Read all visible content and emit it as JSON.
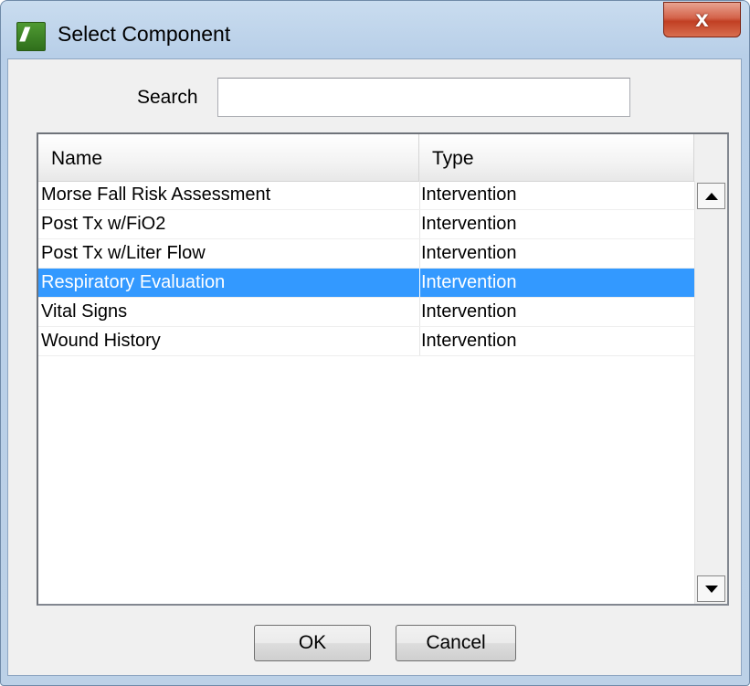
{
  "window": {
    "title": "Select Component",
    "icon": "app-logo-icon",
    "icon_glyph": "///",
    "close_glyph": "x"
  },
  "search": {
    "label": "Search",
    "value": "",
    "placeholder": ""
  },
  "table": {
    "columns": [
      "Name",
      "Type"
    ],
    "rows": [
      {
        "name": "Morse Fall Risk Assessment",
        "type": "Intervention",
        "selected": false
      },
      {
        "name": "Post Tx w/FiO2",
        "type": "Intervention",
        "selected": false
      },
      {
        "name": "Post Tx w/Liter Flow",
        "type": "Intervention",
        "selected": false
      },
      {
        "name": "Respiratory Evaluation",
        "type": "Intervention",
        "selected": true
      },
      {
        "name": "Vital Signs",
        "type": "Intervention",
        "selected": false
      },
      {
        "name": "Wound History",
        "type": "Intervention",
        "selected": false
      }
    ]
  },
  "buttons": {
    "ok_label": "OK",
    "cancel_label": "Cancel"
  },
  "colors": {
    "selection": "#3399ff",
    "close_button": "#c13f23",
    "title_bar": "#c9dcef"
  }
}
